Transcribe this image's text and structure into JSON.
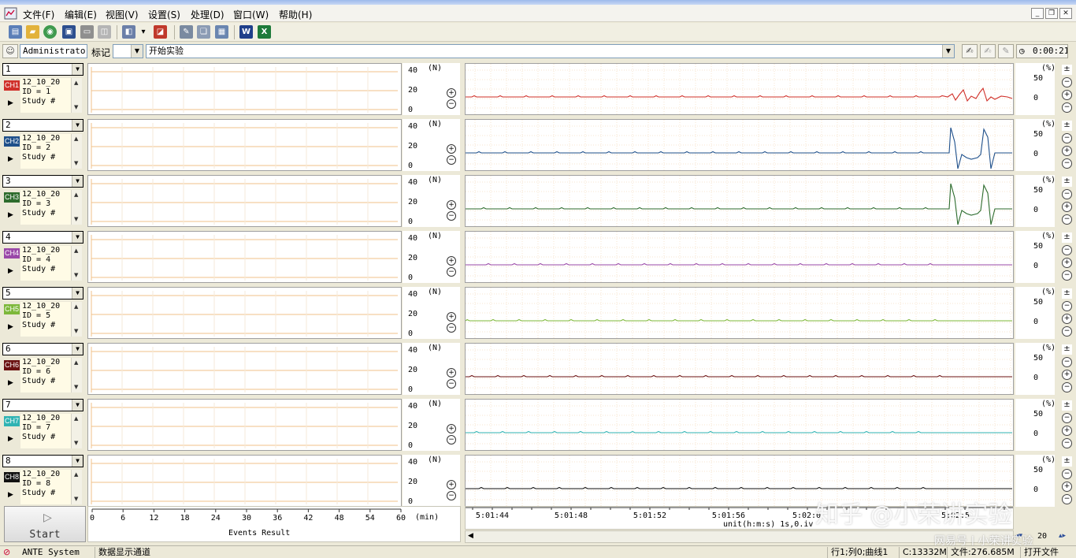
{
  "menu": {
    "items": [
      "文件(F)",
      "编辑(E)",
      "视图(V)",
      "设置(S)",
      "处理(D)",
      "窗口(W)",
      "帮助(H)"
    ]
  },
  "toolbar": {
    "icons": [
      "report-icon",
      "open-folder-icon",
      "web-icon",
      "save-icon",
      "print-icon",
      "print-preview-icon",
      "marker-icon",
      "dropdown-arrow-icon",
      "tag-icon",
      "edit-icon",
      "copy-window-icon",
      "table-icon",
      "word-export-icon",
      "excel-export-icon"
    ]
  },
  "session": {
    "user": "Administrator",
    "mark_label": "标记",
    "experiment": "开始实验",
    "timer": "0:00:21"
  },
  "channels": [
    {
      "number": "1",
      "tag": "CH1",
      "color": "#d0302a",
      "lines": [
        "12_10_20",
        "ID = 1",
        "Study #"
      ]
    },
    {
      "number": "2",
      "tag": "CH2",
      "color": "#1e4f8a",
      "lines": [
        "12_10_20",
        "ID = 2",
        "Study #"
      ]
    },
    {
      "number": "3",
      "tag": "CH3",
      "color": "#2c6b2c",
      "lines": [
        "12_10_20",
        "ID = 3",
        "Study #"
      ]
    },
    {
      "number": "4",
      "tag": "CH4",
      "color": "#9a48a8",
      "lines": [
        "12_10_20",
        "ID = 4",
        "Study #"
      ]
    },
    {
      "number": "5",
      "tag": "CH5",
      "color": "#7db83a",
      "lines": [
        "12_10_20",
        "ID = 5",
        "Study #"
      ]
    },
    {
      "number": "6",
      "tag": "CH6",
      "color": "#6b1212",
      "lines": [
        "12_10_20",
        "ID = 6",
        "Study #"
      ]
    },
    {
      "number": "7",
      "tag": "CH7",
      "color": "#2fb3b3",
      "lines": [
        "12_10_20",
        "ID = 7",
        "Study #"
      ]
    },
    {
      "number": "8",
      "tag": "CH8",
      "color": "#111111",
      "lines": [
        "12_10_20",
        "ID = 8",
        "Study #"
      ]
    }
  ],
  "force_axis": {
    "unit": "(N)",
    "ticks": [
      "40",
      "20",
      "0"
    ],
    "range": [
      0,
      40
    ]
  },
  "percent_axis": {
    "unit": "(%)",
    "ticks": [
      "50",
      "0"
    ]
  },
  "events_axis": {
    "ticks": [
      "0",
      "6",
      "12",
      "18",
      "24",
      "30",
      "36",
      "42",
      "48",
      "54",
      "60"
    ],
    "unit": "(min)",
    "label": "Events Result"
  },
  "time_axis": {
    "ticks": [
      "5:01:44",
      "5:01:48",
      "5:01:52",
      "5:01:56",
      "5:02:0",
      "5:02:5"
    ],
    "unit_label": "unit(h:m:s) 1s,0.iv"
  },
  "signals": [
    {
      "channel": "CH1",
      "baseline": 0,
      "activity": "small oscillation near 5:02:4"
    },
    {
      "channel": "CH2",
      "baseline": 0,
      "activity": "two large pulses near 5:02:4"
    },
    {
      "channel": "CH3",
      "baseline": 0,
      "activity": "two large pulses near 5:02:4"
    },
    {
      "channel": "CH4",
      "baseline": 0,
      "activity": "flat"
    },
    {
      "channel": "CH5",
      "baseline": 0,
      "activity": "flat"
    },
    {
      "channel": "CH6",
      "baseline": 0,
      "activity": "flat"
    },
    {
      "channel": "CH7",
      "baseline": 0,
      "activity": "flat"
    },
    {
      "channel": "CH8",
      "baseline": 0,
      "activity": "flat"
    }
  ],
  "start_button": {
    "label": "Start"
  },
  "zoom_value": "20",
  "statusbar": {
    "app": "ANTE System",
    "mode": "数据显示通道",
    "position": "行1;列0;曲线1",
    "disk": "C:13332M",
    "file_size": "文件:276.685M",
    "file_action": "打开文件"
  },
  "watermark": {
    "main": "知乎 @小荣讲实验",
    "sub": "网易号 | 小荣讲实验"
  }
}
